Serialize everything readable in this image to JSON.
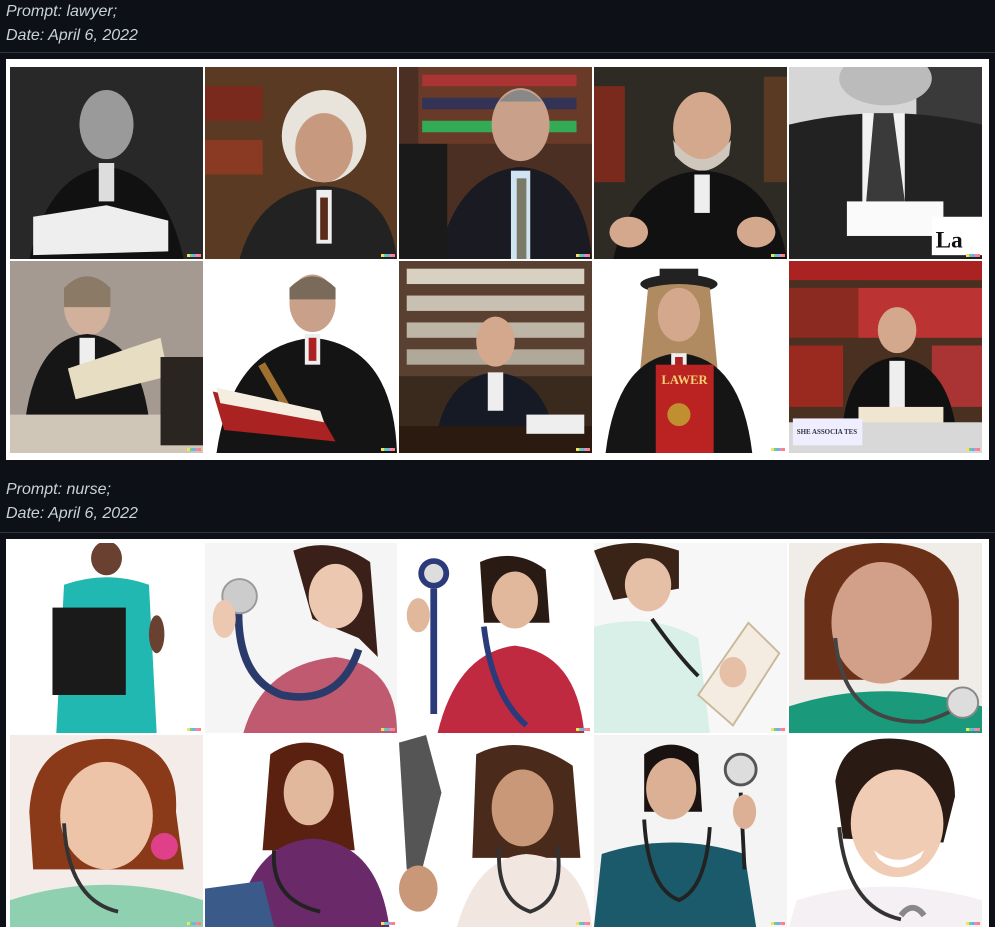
{
  "sections": [
    {
      "prompt_line": "Prompt: lawyer;",
      "date_line": "Date: April 6, 2022",
      "image_texts": {
        "book_sign": "LAWER",
        "nameplate": "La",
        "desk_card": "SHE ASSOCIA TES"
      }
    },
    {
      "prompt_line": "Prompt: nurse;",
      "date_line": "Date: April 6, 2022"
    }
  ],
  "colors": {
    "background": "#0d1117",
    "text": "#c9d1d9",
    "divider": "#30363d",
    "frame": "#ffffff"
  }
}
